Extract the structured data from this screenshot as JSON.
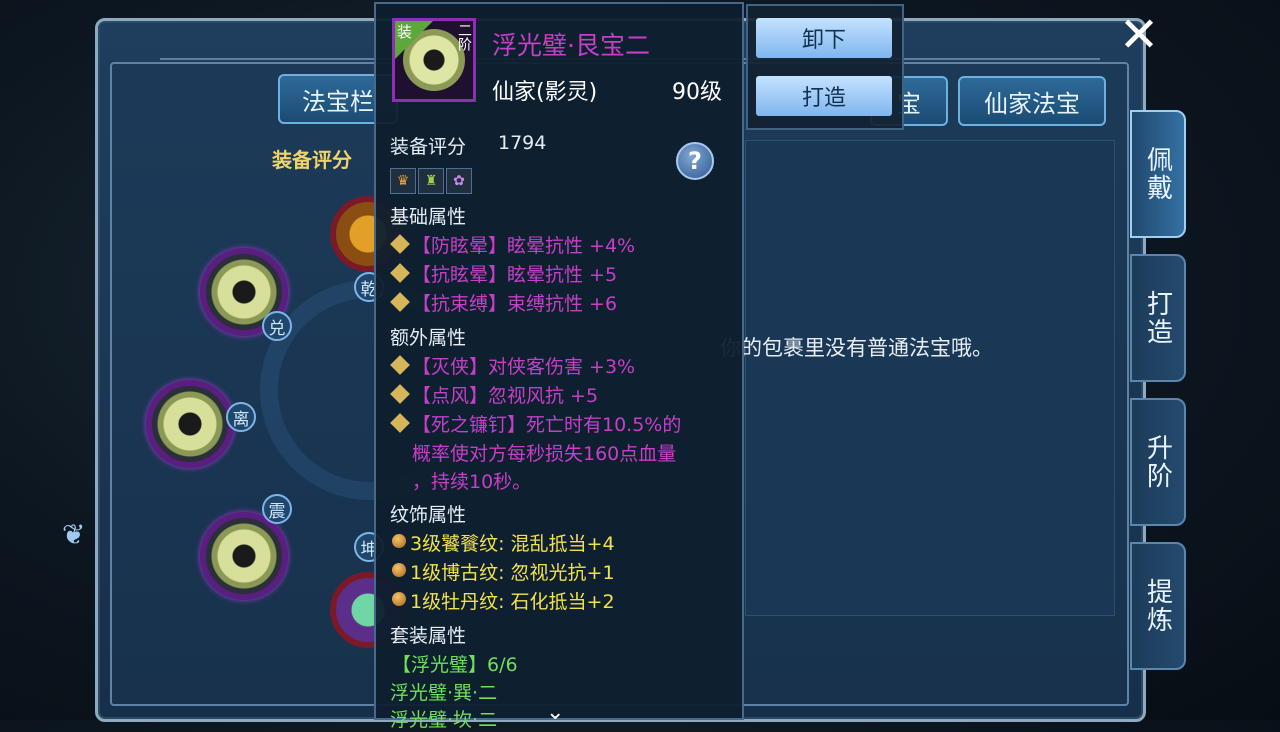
{
  "header": {
    "top_tabs": [
      "法宝栏",
      "宝",
      "仙家法宝"
    ],
    "close_icon": "close-icon"
  },
  "left": {
    "score_label": "装备评分",
    "trigrams": [
      "兑",
      "离",
      "震",
      "坤",
      "乾"
    ]
  },
  "side_tabs": [
    "佩戴",
    "打造",
    "升阶",
    "提炼"
  ],
  "empty_message": "你的包裹里没有普通法宝哦。",
  "actions": {
    "unequip": "卸下",
    "forge": "打造"
  },
  "tooltip": {
    "item_name": "浮光璧·艮宝二",
    "badge_equipped": "装",
    "badge_tier": "二阶",
    "sect": "仙家(影灵)",
    "level": "90级",
    "score_label": "装备评分",
    "score_value": "1794",
    "help": "?",
    "sections": {
      "base_title": "基础属性",
      "base": [
        "【防眩晕】眩晕抗性 +4%",
        "【抗眩晕】眩晕抗性 +5",
        "【抗束缚】束缚抗性 +6"
      ],
      "extra_title": "额外属性",
      "extra": [
        "【灭侠】对侠客伤害 +3%",
        "【点风】忽视风抗 +5",
        "【死之镰钉】死亡时有10.5%的",
        "概率使对方每秒损失160点血量",
        "，持续10秒。"
      ],
      "pattern_title": "纹饰属性",
      "patterns": [
        "3级饕餮纹: 混乱抵当+4",
        "1级博古纹: 忽视光抗+1",
        "1级牡丹纹: 石化抵当+2"
      ],
      "set_title": "套装属性",
      "set": [
        "【浮光璧】6/6",
        "浮光璧·巽·二",
        "浮光璧·坎·二"
      ]
    }
  }
}
